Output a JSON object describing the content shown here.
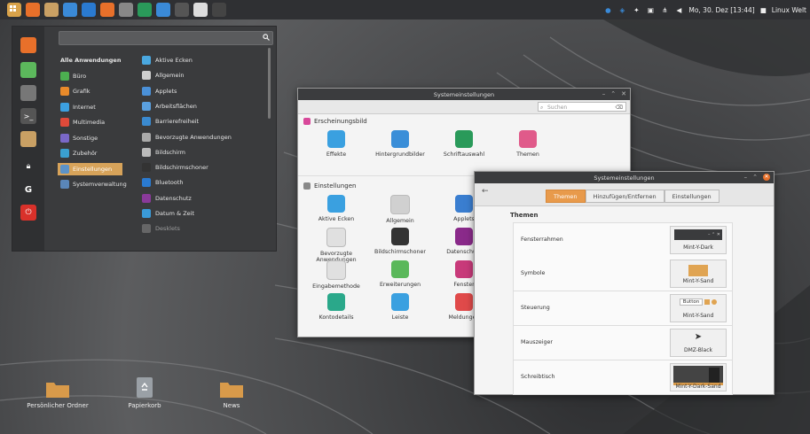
{
  "panel": {
    "clock": "Mo, 30. Dez [13:44]",
    "user": "Linux Welt",
    "apps": [
      "menu-icon",
      "mint-icon",
      "folder-icon",
      "chat-icon",
      "screenshot-icon",
      "media-icon",
      "settings-icon",
      "terminal-icon",
      "spreadsheet-icon",
      "photo-icon",
      "save-icon",
      "terminal2-icon"
    ]
  },
  "menu": {
    "search_placeholder": "",
    "categories": [
      {
        "label": "Alle Anwendungen",
        "color": "transparent"
      },
      {
        "label": "Büro",
        "color": "#4caf50"
      },
      {
        "label": "Grafik",
        "color": "#e88a2a"
      },
      {
        "label": "Internet",
        "color": "#3ca0e0"
      },
      {
        "label": "Multimedia",
        "color": "#e04a3a"
      },
      {
        "label": "Sonstige",
        "color": "#7a68c8"
      },
      {
        "label": "Zubehör",
        "color": "#3aa0d0"
      },
      {
        "label": "Einstellungen",
        "color": "#5c93c8"
      },
      {
        "label": "Systemverwaltung",
        "color": "#5a86b8"
      }
    ],
    "apps": [
      {
        "label": "Aktive Ecken",
        "color": "#4aa8e0"
      },
      {
        "label": "Allgemein",
        "color": "#cfcfcf"
      },
      {
        "label": "Applets",
        "color": "#4a90d8"
      },
      {
        "label": "Arbeitsflächen",
        "color": "#5aa0e0"
      },
      {
        "label": "Barrierefreiheit",
        "color": "#3a8ad0"
      },
      {
        "label": "Bevorzugte Anwendungen",
        "color": "#aaaaaa"
      },
      {
        "label": "Bildschirm",
        "color": "#bbbbbb"
      },
      {
        "label": "Bildschirmschoner",
        "color": "#333333"
      },
      {
        "label": "Bluetooth",
        "color": "#2a7ad0"
      },
      {
        "label": "Datenschutz",
        "color": "#8a3a9a"
      },
      {
        "label": "Datum & Zeit",
        "color": "#3a9ad8"
      },
      {
        "label": "Desklets",
        "color": "#8a8a8a"
      }
    ],
    "favorites": [
      {
        "name": "firefox-icon",
        "color": "#e8702a"
      },
      {
        "name": "mint-software-icon",
        "color": "#5cb85c"
      },
      {
        "name": "settings-icon",
        "color": "#777"
      },
      {
        "name": "terminal-icon",
        "color": "#555"
      },
      {
        "name": "files-icon",
        "color": "#c9a064"
      },
      {
        "name": "lock-icon",
        "color": "#555"
      },
      {
        "name": "logout-icon",
        "color": "#555"
      },
      {
        "name": "power-icon",
        "color": "#d9312a"
      }
    ]
  },
  "desktop": {
    "icons": [
      {
        "label": "Persönlicher Ordner"
      },
      {
        "label": "Papierkorb"
      },
      {
        "label": "News"
      }
    ]
  },
  "settings_window": {
    "title": "Systemeinstellungen",
    "search_placeholder": "Suchen",
    "section1": "Erscheinungsbild",
    "section2": "Einstellungen",
    "appearance_items": [
      {
        "label": "Effekte",
        "color": "#3aa0e0"
      },
      {
        "label": "Hintergrundbilder",
        "color": "#3a8ed8"
      },
      {
        "label": "Schriftauswahl",
        "color": "#2a9a5a"
      },
      {
        "label": "Themen",
        "color": "#e05a8a"
      }
    ],
    "pref_items": [
      {
        "label": "Aktive Ecken",
        "color": "#3aa0e0"
      },
      {
        "label": "Allgemein",
        "color": "#d0d0d0"
      },
      {
        "label": "Applets",
        "color": "#3a7ed0"
      },
      {
        "label": "Bevorzugte Anwendungen",
        "color": "#e0e0e0"
      },
      {
        "label": "Bildschirmschoner",
        "color": "#333"
      },
      {
        "label": "Datenschutz",
        "color": "#8a2a8a"
      },
      {
        "label": "Eingabemethode",
        "color": "#e0e0e0"
      },
      {
        "label": "Erweiterungen",
        "color": "#5ab85a"
      },
      {
        "label": "Fenster",
        "color": "#c83a7a"
      },
      {
        "label": "Kontodetails",
        "color": "#2aa88a"
      },
      {
        "label": "Leiste",
        "color": "#3aa0e0"
      },
      {
        "label": "Meldungen",
        "color": "#e04a4a"
      }
    ]
  },
  "themes_window": {
    "title": "Systemeinstellungen",
    "tabs": [
      "Themen",
      "Hinzufügen/Entfernen",
      "Einstellungen"
    ],
    "heading": "Themen",
    "rows": [
      {
        "label": "Fensterrahmen",
        "value": "Mint-Y-Dark"
      },
      {
        "label": "Symbole",
        "value": "Mint-Y-Sand"
      },
      {
        "label": "Steuerung",
        "value": "Mint-Y-Sand",
        "button": "Button"
      },
      {
        "label": "Mauszeiger",
        "value": "DMZ-Black"
      },
      {
        "label": "Schreibtisch",
        "value": "Mint-Y-Dark-Sand"
      }
    ]
  }
}
